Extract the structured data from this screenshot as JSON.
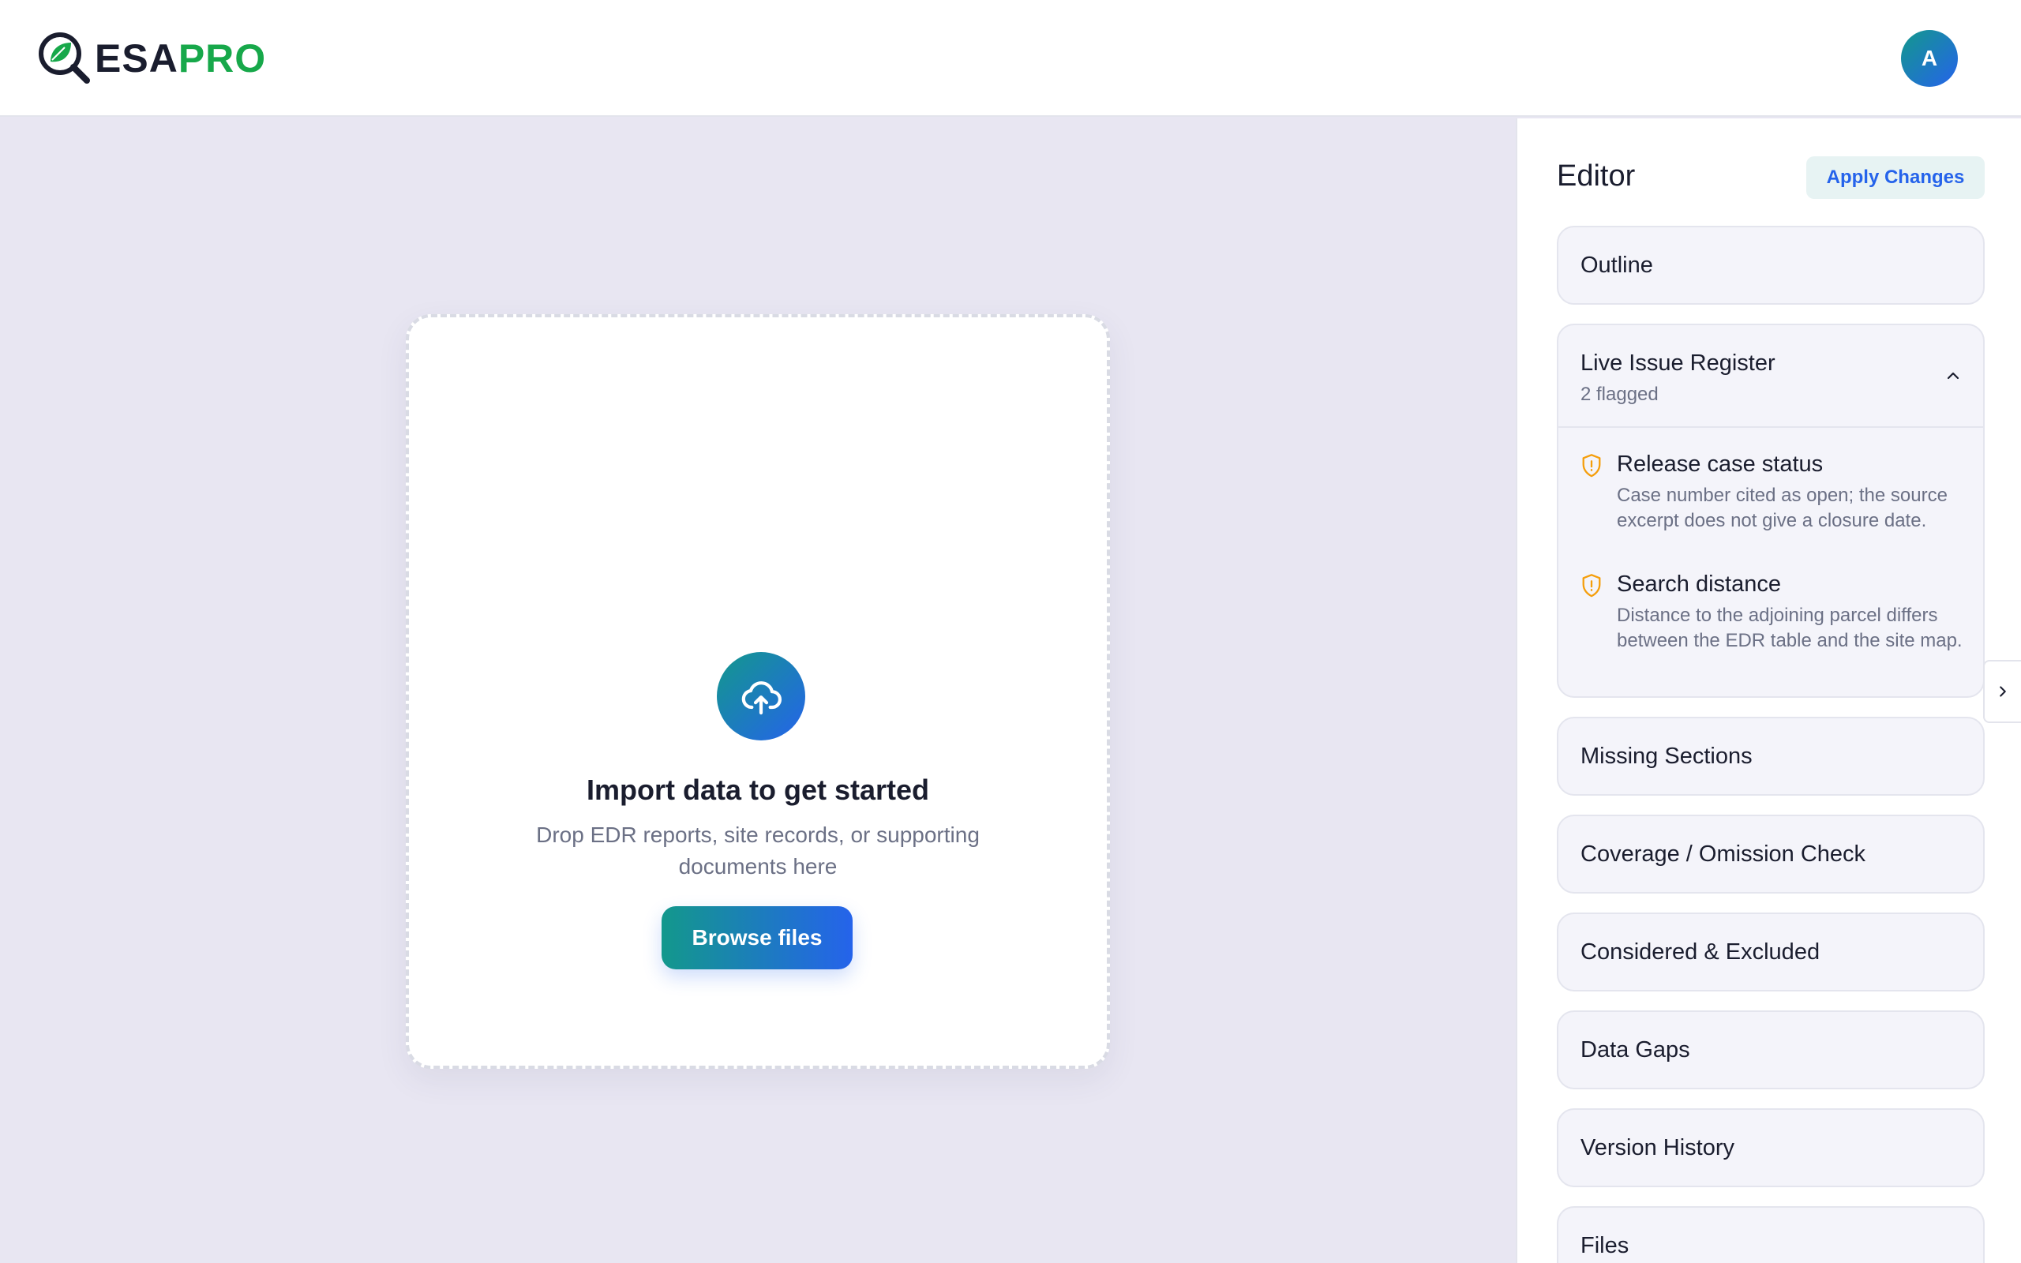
{
  "header": {
    "logo": {
      "part1": "ESA",
      "part2": "PRO"
    },
    "avatar_initial": "A"
  },
  "upload": {
    "title": "Import data to get started",
    "subtitle": "Drop EDR reports, site records, or supporting documents here",
    "browse_label": "Browse files",
    "icon": "cloud-upload-icon"
  },
  "editor": {
    "title": "Editor",
    "apply_label": "Apply Changes",
    "sections": {
      "outline": "Outline",
      "live_issue_register": {
        "title": "Live Issue Register",
        "count": "2 flagged",
        "issues": [
          {
            "title": "Release case status",
            "description": "Case number cited as open; the source excerpt does not give a closure date."
          },
          {
            "title": "Search distance",
            "description": "Distance to the adjoining parcel differs between the EDR table and the site map."
          }
        ]
      },
      "missing_sections": "Missing Sections",
      "coverage": "Coverage / Omission Check",
      "considered": "Considered & Excluded",
      "data_gaps": "Data Gaps",
      "version_history": "Version History",
      "files": "Files"
    }
  },
  "colors": {
    "brand_green": "#17a84a",
    "gradient_start": "#13988c",
    "gradient_end": "#2563eb",
    "warning": "#f59e0b",
    "background": "#e8e6f2"
  }
}
